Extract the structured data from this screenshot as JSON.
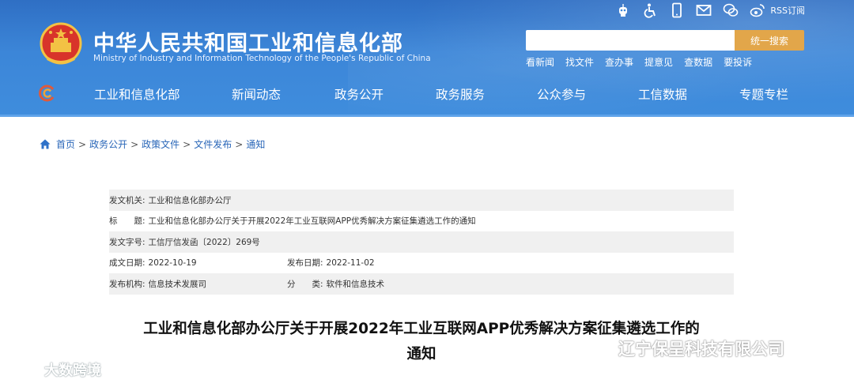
{
  "header": {
    "title": "中华人民共和国工业和信息化部",
    "subtitle": "Ministry of Industry and Information Technology of the People's Republic of China",
    "rss_label": "RSS订阅",
    "search": {
      "placeholder": "",
      "button_label": "统一搜索"
    },
    "quick_links": [
      "看新闻",
      "找文件",
      "查办事",
      "提意见",
      "查数据",
      "要投诉"
    ],
    "nav": [
      "工业和信息化部",
      "新闻动态",
      "政务公开",
      "政务服务",
      "公众参与",
      "工信数据",
      "专题专栏"
    ],
    "top_icons": [
      "robot-icon",
      "accessibility-icon",
      "mobile-icon",
      "mail-icon",
      "wechat-icon",
      "weibo-icon"
    ]
  },
  "breadcrumb": [
    "首页",
    "政务公开",
    "政策文件",
    "文件发布",
    "通知"
  ],
  "meta": {
    "issuer_label": "发文机关:",
    "issuer": "工业和信息化部办公厅",
    "title_label": "标　　题:",
    "title": "工业和信息化部办公厅关于开展2022年工业互联网APP优秀解决方案征集遴选工作的通知",
    "doc_no_label": "发文字号:",
    "doc_no": "工信厅信发函〔2022〕269号",
    "created_label": "成文日期:",
    "created": "2022-10-19",
    "published_label": "发布日期:",
    "published": "2022-11-02",
    "agency_label": "发布机构:",
    "agency": "信息技术发展司",
    "category_label": "分　　类:",
    "category": "软件和信息技术"
  },
  "document": {
    "title_line1": "工业和信息化部办公厅关于开展2022年工业互联网APP优秀解决方案征集遴选工作的",
    "title_line2": "通知"
  },
  "watermarks": {
    "left": "大数跨境",
    "right": "辽宁保呈科技有限公司"
  },
  "colors": {
    "header_blue": "#3c86d8",
    "search_button": "#e2a64a",
    "breadcrumb_link": "#2966b8"
  }
}
